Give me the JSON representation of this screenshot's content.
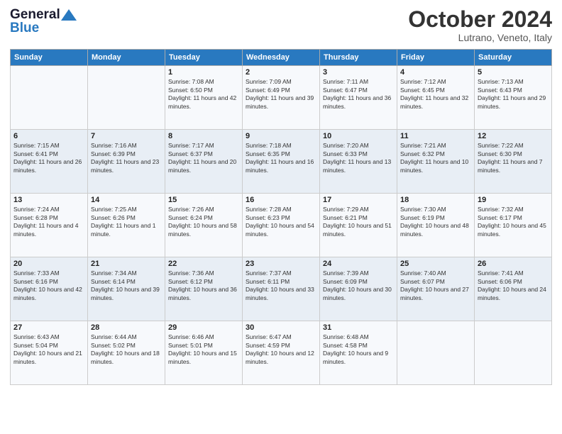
{
  "header": {
    "logo_general": "General",
    "logo_blue": "Blue",
    "month_title": "October 2024",
    "location": "Lutrano, Veneto, Italy"
  },
  "days_of_week": [
    "Sunday",
    "Monday",
    "Tuesday",
    "Wednesday",
    "Thursday",
    "Friday",
    "Saturday"
  ],
  "weeks": [
    [
      {
        "day": "",
        "info": ""
      },
      {
        "day": "",
        "info": ""
      },
      {
        "day": "1",
        "sunrise": "Sunrise: 7:08 AM",
        "sunset": "Sunset: 6:50 PM",
        "daylight": "Daylight: 11 hours and 42 minutes."
      },
      {
        "day": "2",
        "sunrise": "Sunrise: 7:09 AM",
        "sunset": "Sunset: 6:49 PM",
        "daylight": "Daylight: 11 hours and 39 minutes."
      },
      {
        "day": "3",
        "sunrise": "Sunrise: 7:11 AM",
        "sunset": "Sunset: 6:47 PM",
        "daylight": "Daylight: 11 hours and 36 minutes."
      },
      {
        "day": "4",
        "sunrise": "Sunrise: 7:12 AM",
        "sunset": "Sunset: 6:45 PM",
        "daylight": "Daylight: 11 hours and 32 minutes."
      },
      {
        "day": "5",
        "sunrise": "Sunrise: 7:13 AM",
        "sunset": "Sunset: 6:43 PM",
        "daylight": "Daylight: 11 hours and 29 minutes."
      }
    ],
    [
      {
        "day": "6",
        "sunrise": "Sunrise: 7:15 AM",
        "sunset": "Sunset: 6:41 PM",
        "daylight": "Daylight: 11 hours and 26 minutes."
      },
      {
        "day": "7",
        "sunrise": "Sunrise: 7:16 AM",
        "sunset": "Sunset: 6:39 PM",
        "daylight": "Daylight: 11 hours and 23 minutes."
      },
      {
        "day": "8",
        "sunrise": "Sunrise: 7:17 AM",
        "sunset": "Sunset: 6:37 PM",
        "daylight": "Daylight: 11 hours and 20 minutes."
      },
      {
        "day": "9",
        "sunrise": "Sunrise: 7:18 AM",
        "sunset": "Sunset: 6:35 PM",
        "daylight": "Daylight: 11 hours and 16 minutes."
      },
      {
        "day": "10",
        "sunrise": "Sunrise: 7:20 AM",
        "sunset": "Sunset: 6:33 PM",
        "daylight": "Daylight: 11 hours and 13 minutes."
      },
      {
        "day": "11",
        "sunrise": "Sunrise: 7:21 AM",
        "sunset": "Sunset: 6:32 PM",
        "daylight": "Daylight: 11 hours and 10 minutes."
      },
      {
        "day": "12",
        "sunrise": "Sunrise: 7:22 AM",
        "sunset": "Sunset: 6:30 PM",
        "daylight": "Daylight: 11 hours and 7 minutes."
      }
    ],
    [
      {
        "day": "13",
        "sunrise": "Sunrise: 7:24 AM",
        "sunset": "Sunset: 6:28 PM",
        "daylight": "Daylight: 11 hours and 4 minutes."
      },
      {
        "day": "14",
        "sunrise": "Sunrise: 7:25 AM",
        "sunset": "Sunset: 6:26 PM",
        "daylight": "Daylight: 11 hours and 1 minute."
      },
      {
        "day": "15",
        "sunrise": "Sunrise: 7:26 AM",
        "sunset": "Sunset: 6:24 PM",
        "daylight": "Daylight: 10 hours and 58 minutes."
      },
      {
        "day": "16",
        "sunrise": "Sunrise: 7:28 AM",
        "sunset": "Sunset: 6:23 PM",
        "daylight": "Daylight: 10 hours and 54 minutes."
      },
      {
        "day": "17",
        "sunrise": "Sunrise: 7:29 AM",
        "sunset": "Sunset: 6:21 PM",
        "daylight": "Daylight: 10 hours and 51 minutes."
      },
      {
        "day": "18",
        "sunrise": "Sunrise: 7:30 AM",
        "sunset": "Sunset: 6:19 PM",
        "daylight": "Daylight: 10 hours and 48 minutes."
      },
      {
        "day": "19",
        "sunrise": "Sunrise: 7:32 AM",
        "sunset": "Sunset: 6:17 PM",
        "daylight": "Daylight: 10 hours and 45 minutes."
      }
    ],
    [
      {
        "day": "20",
        "sunrise": "Sunrise: 7:33 AM",
        "sunset": "Sunset: 6:16 PM",
        "daylight": "Daylight: 10 hours and 42 minutes."
      },
      {
        "day": "21",
        "sunrise": "Sunrise: 7:34 AM",
        "sunset": "Sunset: 6:14 PM",
        "daylight": "Daylight: 10 hours and 39 minutes."
      },
      {
        "day": "22",
        "sunrise": "Sunrise: 7:36 AM",
        "sunset": "Sunset: 6:12 PM",
        "daylight": "Daylight: 10 hours and 36 minutes."
      },
      {
        "day": "23",
        "sunrise": "Sunrise: 7:37 AM",
        "sunset": "Sunset: 6:11 PM",
        "daylight": "Daylight: 10 hours and 33 minutes."
      },
      {
        "day": "24",
        "sunrise": "Sunrise: 7:39 AM",
        "sunset": "Sunset: 6:09 PM",
        "daylight": "Daylight: 10 hours and 30 minutes."
      },
      {
        "day": "25",
        "sunrise": "Sunrise: 7:40 AM",
        "sunset": "Sunset: 6:07 PM",
        "daylight": "Daylight: 10 hours and 27 minutes."
      },
      {
        "day": "26",
        "sunrise": "Sunrise: 7:41 AM",
        "sunset": "Sunset: 6:06 PM",
        "daylight": "Daylight: 10 hours and 24 minutes."
      }
    ],
    [
      {
        "day": "27",
        "sunrise": "Sunrise: 6:43 AM",
        "sunset": "Sunset: 5:04 PM",
        "daylight": "Daylight: 10 hours and 21 minutes."
      },
      {
        "day": "28",
        "sunrise": "Sunrise: 6:44 AM",
        "sunset": "Sunset: 5:02 PM",
        "daylight": "Daylight: 10 hours and 18 minutes."
      },
      {
        "day": "29",
        "sunrise": "Sunrise: 6:46 AM",
        "sunset": "Sunset: 5:01 PM",
        "daylight": "Daylight: 10 hours and 15 minutes."
      },
      {
        "day": "30",
        "sunrise": "Sunrise: 6:47 AM",
        "sunset": "Sunset: 4:59 PM",
        "daylight": "Daylight: 10 hours and 12 minutes."
      },
      {
        "day": "31",
        "sunrise": "Sunrise: 6:48 AM",
        "sunset": "Sunset: 4:58 PM",
        "daylight": "Daylight: 10 hours and 9 minutes."
      },
      {
        "day": "",
        "info": ""
      },
      {
        "day": "",
        "info": ""
      }
    ]
  ]
}
